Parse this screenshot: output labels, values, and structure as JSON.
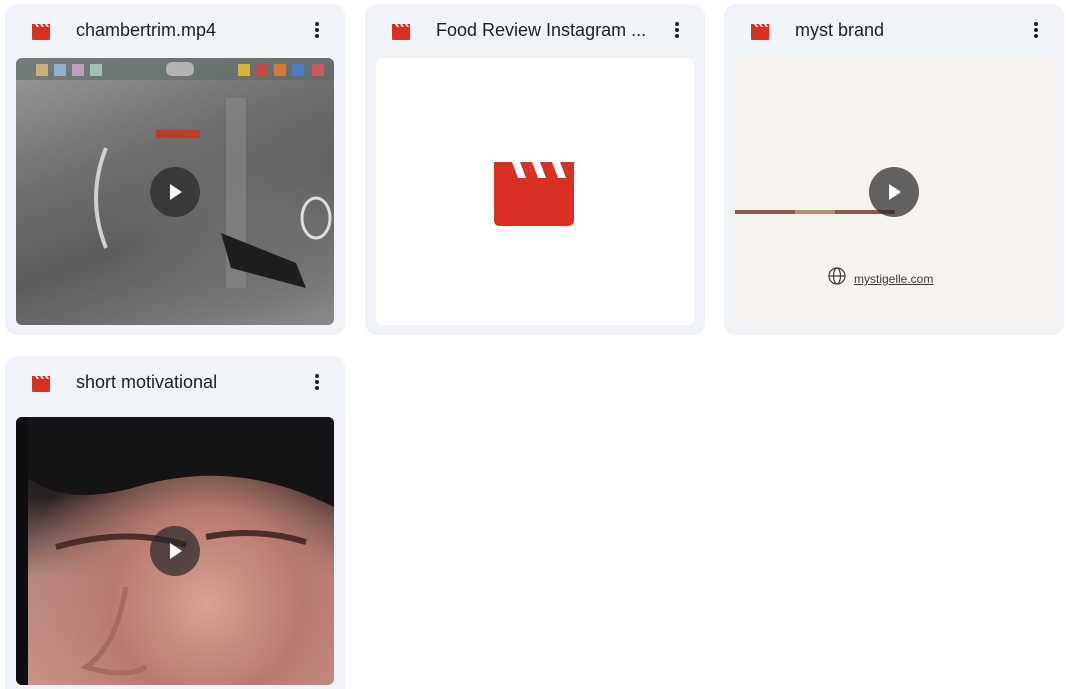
{
  "colors": {
    "card_bg": "#f0f4f9",
    "video_icon_red": "#d93025",
    "title_text": "#1f1f1f"
  },
  "files": [
    {
      "title": "chambertrim.mp4",
      "icon": "video-clapperboard-icon",
      "thumbnail": "gameplay-still",
      "has_play": true
    },
    {
      "title": "Food Review Instagram ...",
      "icon": "video-clapperboard-icon",
      "thumbnail": "no-preview-clapperboard",
      "has_play": false
    },
    {
      "title": "myst brand",
      "icon": "video-clapperboard-icon",
      "thumbnail": "brand-card",
      "thumbnail_text": "mystigelle.com",
      "has_play": true
    },
    {
      "title": "short motivational",
      "icon": "video-clapperboard-icon",
      "thumbnail": "closeup-face",
      "has_play": true
    }
  ],
  "more_icon": "more-vert-icon",
  "play_icon": "play-icon"
}
